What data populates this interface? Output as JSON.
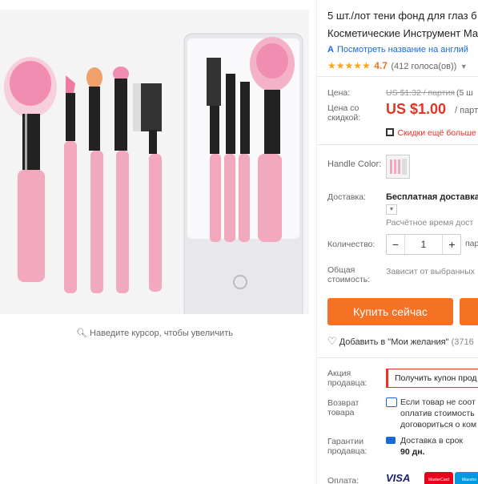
{
  "image": {
    "zoom_hint": "Наведите курсор, чтобы увеличить"
  },
  "product": {
    "title_line1": "5 шт./лот тени фонд для глаз б",
    "title_line2": "Косметические Инструмент Ма",
    "translate_link": "Посмотреть название на англий",
    "rating_value": "4.7",
    "rating_count": "(412 голоса(ов))"
  },
  "price": {
    "price_label": "Цена:",
    "old_price": "US $1.32 / партия",
    "old_price_extra": "(5 ш",
    "discount_label_1": "Цена со",
    "discount_label_2": "скидкой:",
    "new_price": "US $1.00",
    "per_unit": "/ парт",
    "extra_discount": "Скидки ещё больше"
  },
  "options": {
    "handle_color_label": "Handle Color:"
  },
  "delivery": {
    "label": "Доставка:",
    "value": "Бесплатная доставка",
    "estimate": "Расчётное время дост"
  },
  "quantity": {
    "label": "Количество:",
    "minus": "−",
    "value": "1",
    "plus": "+",
    "unit": "парт"
  },
  "total": {
    "label_1": "Общая",
    "label_2": "стоимость:",
    "value": "Зависит от выбранных"
  },
  "actions": {
    "buy_now": "Купить сейчас",
    "wishlist": "Добавить в \"Мои желания\"",
    "wishlist_count": "(3716"
  },
  "seller_promo": {
    "label_1": "Акция",
    "label_2": "продавца:",
    "coupon": "Получить купон прод"
  },
  "returns": {
    "label_1": "Возврат",
    "label_2": "товара",
    "line1": "Если товар не соот",
    "line2": "оплатив стоимость",
    "line3": "договориться о ком"
  },
  "guarantee": {
    "label_1": "Гарантии",
    "label_2": "продавца:",
    "line1": "Доставка в срок",
    "line2": "90 дн."
  },
  "payment": {
    "label": "Оплата:",
    "visa": "VISA",
    "mastercard": "MasterCard",
    "maestro": "Maestro"
  },
  "colors": {
    "accent_orange": "#f57224",
    "price_red": "#e43225",
    "link_blue": "#1a6ad6",
    "star_gold": "#f9a61a"
  }
}
